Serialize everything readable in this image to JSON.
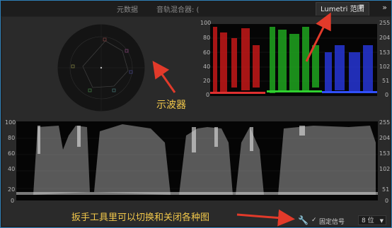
{
  "tabs": [
    {
      "label": "元数据",
      "active": false
    },
    {
      "label": "音轨混合器: (",
      "active": false
    },
    {
      "label": "Lumetri 范围",
      "active": true
    }
  ],
  "tab_menu_icon": "hamburger-icon",
  "overflow_icon": "double-chevron-right-icon",
  "rgb_parade": {
    "left_ticks": [
      "100",
      "80",
      "60",
      "40",
      "20",
      "0"
    ],
    "right_ticks": [
      "255",
      "204",
      "153",
      "102",
      "51",
      "0"
    ],
    "colors": [
      "#c41818",
      "#1fa51f",
      "#2636d6"
    ]
  },
  "waveform": {
    "left_ticks": [
      "100",
      "80",
      "60",
      "40",
      "20",
      "0"
    ],
    "right_ticks": [
      "255",
      "204",
      "153",
      "102",
      "51",
      "0"
    ]
  },
  "annotations": {
    "oscilloscope": "示波器",
    "wrench_tip": "扳手工具里可以切换和关闭各种图"
  },
  "bottom": {
    "wrench_icon": "wrench-icon",
    "clamp_label": "固定信号",
    "clamp_checked": true,
    "bit_depth": "8 位"
  },
  "colors": {
    "accent": "#2e7fb8",
    "annotation": "#f2c84b",
    "arrow": "#e23a2a"
  }
}
